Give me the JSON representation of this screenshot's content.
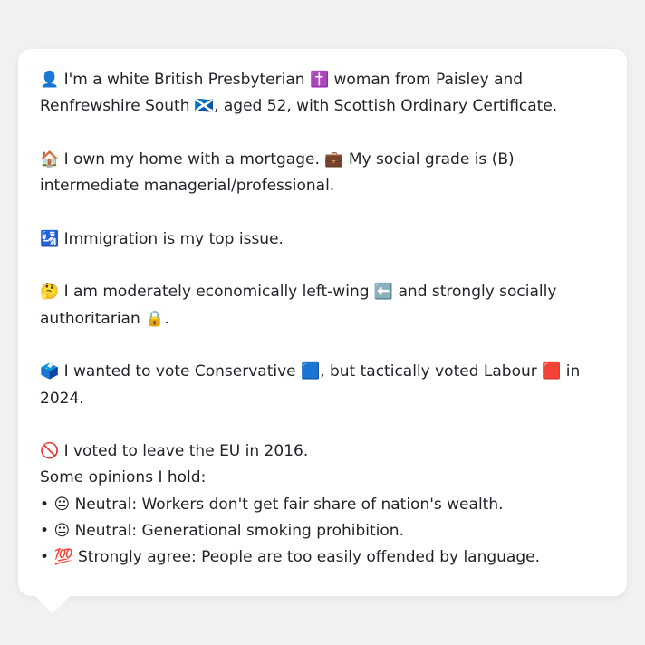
{
  "paragraphs": [
    {
      "id": "identity",
      "parts": [
        {
          "emoji": "👤"
        },
        {
          "text": " I'm a white British Presbyterian "
        },
        {
          "emoji": "✝️"
        },
        {
          "text": " woman from Paisley and Renfrewshire South "
        },
        {
          "emoji": "🏴󠁧󠁢󠁳󠁣󠁴󠁿"
        },
        {
          "text": ", aged 52, with Scottish Ordinary Certificate."
        }
      ]
    },
    {
      "id": "home",
      "parts": [
        {
          "emoji": "🏠"
        },
        {
          "text": " I own my home with a mortgage. "
        },
        {
          "emoji": "💼"
        },
        {
          "text": " My social grade is (B) intermediate managerial/professional."
        }
      ]
    },
    {
      "id": "issue",
      "parts": [
        {
          "emoji": "🛂"
        },
        {
          "text": " Immigration is my top issue."
        }
      ]
    },
    {
      "id": "politics",
      "parts": [
        {
          "emoji": "🤔"
        },
        {
          "text": " I am moderately economically left-wing "
        },
        {
          "emoji": "⬅️"
        },
        {
          "text": " and strongly socially authoritarian "
        },
        {
          "emoji": "🔒"
        },
        {
          "text": "."
        }
      ]
    },
    {
      "id": "vote",
      "parts": [
        {
          "emoji": "🗳️"
        },
        {
          "text": " I wanted to vote Conservative "
        },
        {
          "emoji": "🟦"
        },
        {
          "text": ", but tactically voted Labour "
        },
        {
          "emoji": "🟥"
        },
        {
          "text": " in 2024."
        }
      ]
    },
    {
      "id": "brexit",
      "parts": [
        {
          "emoji": "🚫"
        },
        {
          "text": " I voted to leave the EU in 2016."
        }
      ]
    }
  ],
  "opinions": {
    "heading": "Some opinions I hold:",
    "items": [
      {
        "bullet": "•",
        "emoji": "😐",
        "text": " Neutral: Workers don't get fair share of nation's wealth."
      },
      {
        "bullet": "•",
        "emoji": "😐",
        "text": " Neutral: Generational smoking prohibition."
      },
      {
        "bullet": "•",
        "emoji": "💯",
        "text": " Strongly agree: People are too easily offended by language."
      }
    ]
  }
}
